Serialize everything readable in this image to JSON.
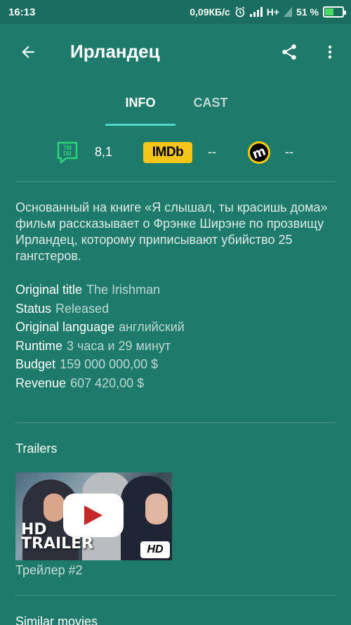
{
  "status_bar": {
    "time": "16:13",
    "net_speed": "0,09КБ/с",
    "network": "H+",
    "battery_percent": "51 %",
    "battery_level": 0.51
  },
  "toolbar": {
    "title": "Ирландец",
    "back_icon": "arrow-left-icon",
    "share_icon": "share-icon",
    "more_icon": "more-vert-icon"
  },
  "tabs": [
    {
      "label": "INFO",
      "active": true
    },
    {
      "label": "CAST",
      "active": false
    }
  ],
  "ratings": {
    "tmdb": {
      "icon": "tmdb-icon",
      "value": "8,1"
    },
    "imdb": {
      "badge": "IMDb",
      "value": "--"
    },
    "metacritic": {
      "icon": "metacritic-icon",
      "value": "--"
    }
  },
  "overview": "Основанный на книге «Я слышал, ты красишь дома» фильм рассказывает о Фрэнке Ширэне по прозвищу Ирландец, которому приписывают убийство 25 гангстеров.",
  "details": [
    {
      "label": "Original title",
      "value": "The Irishman"
    },
    {
      "label": "Status",
      "value": "Released"
    },
    {
      "label": "Original language",
      "value": "английский"
    },
    {
      "label": "Runtime",
      "value": "3 часа и 29 минут"
    },
    {
      "label": "Budget",
      "value": "159 000 000,00 $"
    },
    {
      "label": "Revenue",
      "value": "607 420,00 $"
    }
  ],
  "trailers": {
    "title": "Trailers",
    "items": [
      {
        "overlay_text": "HD TRAILER",
        "badge": "HD",
        "caption": "Трейлер #2"
      }
    ]
  },
  "similar": {
    "title": "Similar movies"
  },
  "colors": {
    "background": "#1e7a6a",
    "accent": "#4fd8c4",
    "imdb_yellow": "#f5c518"
  }
}
